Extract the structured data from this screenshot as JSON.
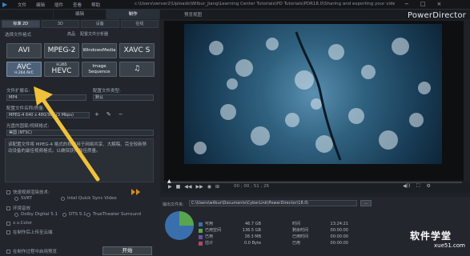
{
  "titlebar": {
    "menu": [
      "文件",
      "编辑",
      "插件",
      "查看",
      "帮助"
    ],
    "path": "c:\\Users\\server2\\Uploads\\Wilbur_Jiang\\Learning Center Tutorials\\PD Tutorials\\PDR18.0\\Sharing and exporting your video\\demo.pds",
    "window_controls": [
      "−",
      "□",
      "×"
    ]
  },
  "modes": [
    "",
    "编辑",
    "制作"
  ],
  "brand": "PowerDirector",
  "tabs": [
    "标准 2D",
    "3D",
    "设备",
    "在线"
  ],
  "subtitle": "选择文件格式",
  "subtabs": [
    "高品",
    "配置文件分析器"
  ],
  "formats": [
    {
      "label": "AVI",
      "sub": ""
    },
    {
      "label": "MPEG-2",
      "sub": ""
    },
    {
      "label": "WindowsMedia",
      "sub": ""
    },
    {
      "label": "XAVC S",
      "sub": ""
    },
    {
      "label": "AVC",
      "sub": "H.264 AVC"
    },
    {
      "label": "HEVC",
      "sub": "H.265"
    },
    {
      "label": "Image Sequence",
      "sub": ""
    },
    {
      "label": "♫",
      "sub": ""
    }
  ],
  "fields": {
    "file_ext_label": "文件扩展名:",
    "file_ext_value": "MP4",
    "profile_type_label": "配置文件类型:",
    "profile_type_value": "默认",
    "profile_name_label": "配置文件名称/质量:",
    "profile_name_value": "MPEG-4 640 x 480/30p (3 Mbps)",
    "country_label": "光盘的国家/视频格式:",
    "country_value": "美国 (NTSC)"
  },
  "description": "该配置文件将 MPEG-4 格式的视频用于网络共享、大解稿、完全较新移动设备的最佳视频格式。以确保获得最佳质量。",
  "options": {
    "fast_render_label": "快速视频渲染技术:",
    "svrt_label": "SVRT",
    "quick_sync_label": "Intel Quick Sync Video",
    "audio_label": "环境音效",
    "dolby_label": "Dolby Digital 5.1",
    "dts_label": "DTS 5.1",
    "truetheater_label": "TrueTheater Surround",
    "xvcolor_label": "x.v.Color",
    "upload_label": "在制作后上传至云端",
    "preview_label": "在制作过程中启用预览",
    "start_button": "开始"
  },
  "preview_header": "预览视图",
  "playback": {
    "timecode": "00 ; 00 ; 51 ; 26",
    "controls": [
      "▶",
      "■",
      "◀◀",
      "▶▶",
      "◉",
      "⊞"
    ]
  },
  "output": {
    "folder_label": "输出文件夹:",
    "folder_value": "C:\\Users\\wilbur\\Documents\\CyberLink\\PowerDirector\\18.0\\"
  },
  "disk_stats": [
    {
      "label": "可用",
      "value": "46.7",
      "unit": "GB",
      "color": "#3a6fae"
    },
    {
      "label": "已用空间",
      "value": "136.5",
      "unit": "GB",
      "color": "#58a64e"
    },
    {
      "label": "已用",
      "value": "38.3",
      "unit": "MB",
      "color": "#6e4fa2"
    },
    {
      "label": "估计",
      "value": "0.0",
      "unit": "Byte",
      "color": "#b0486b"
    }
  ],
  "time_stats": [
    {
      "label": "时间",
      "value": "13:24:21"
    },
    {
      "label": "剩余时间",
      "value": "00:00:00"
    },
    {
      "label": "已用时间",
      "value": "00:00:00"
    },
    {
      "label": "已用",
      "value": "00:00:00"
    }
  ],
  "watermark": {
    "title": "软件学堂",
    "sub": "xue51.com"
  },
  "colors": {
    "accent": "#2b87d6",
    "arrow": "#f0c23a"
  }
}
